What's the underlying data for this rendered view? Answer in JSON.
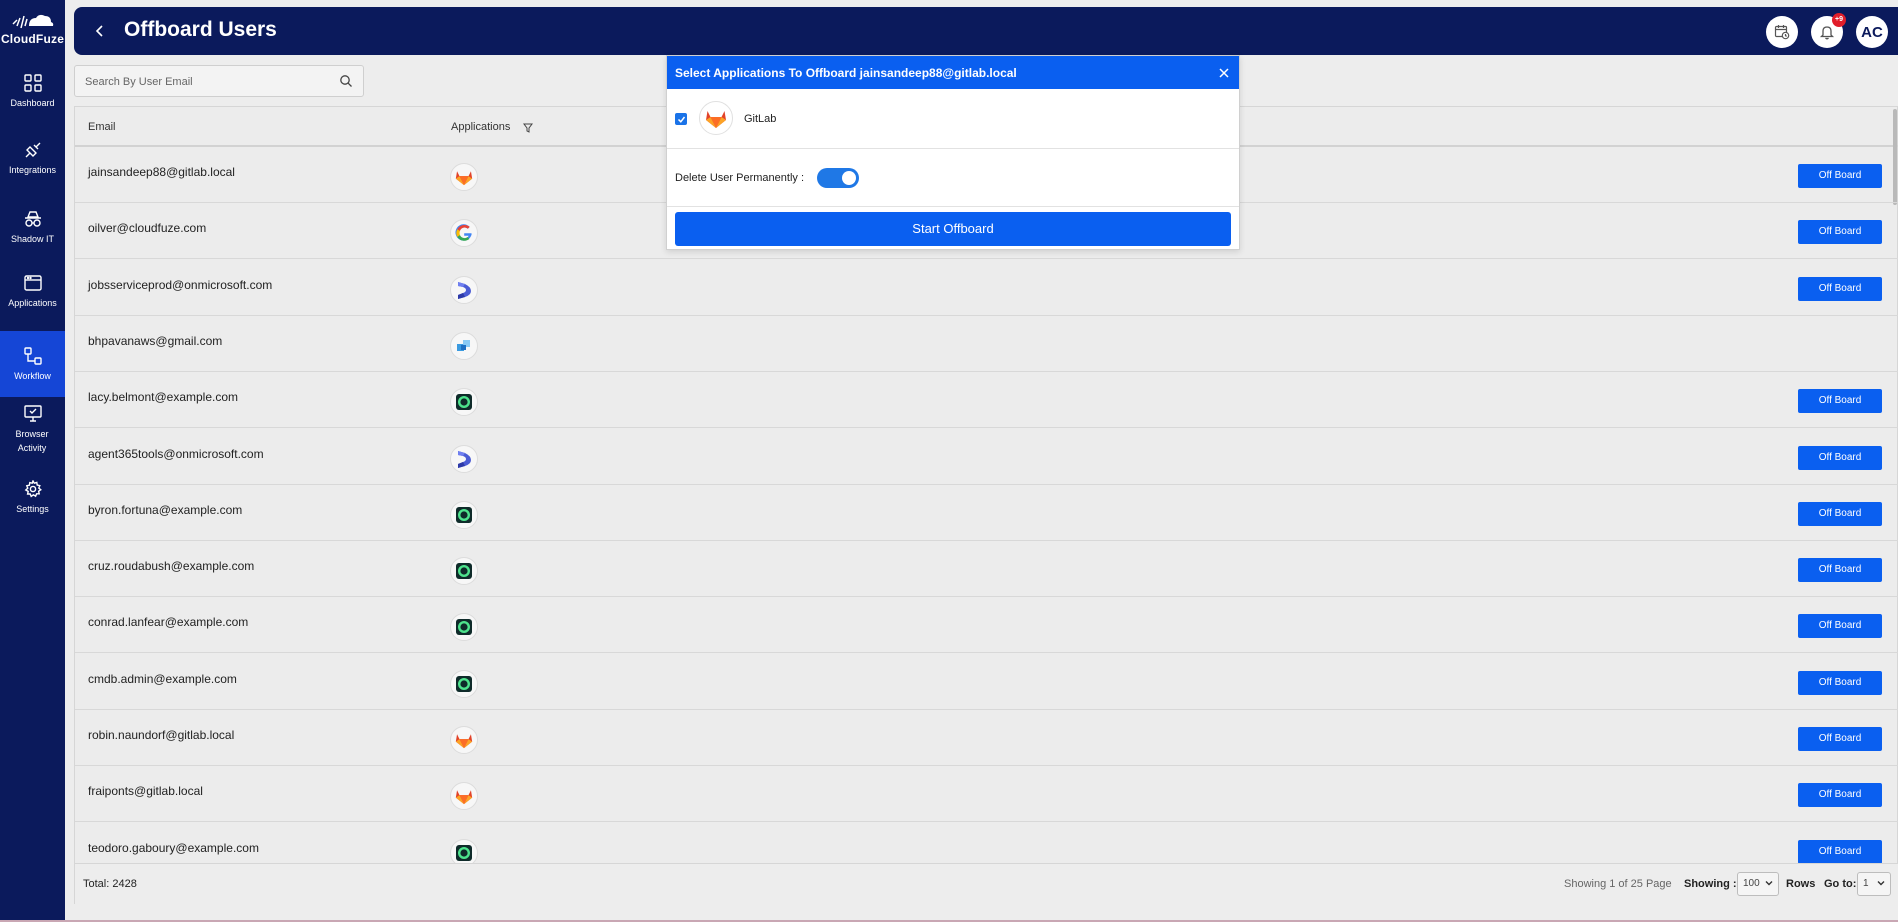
{
  "brand": {
    "name": "CloudFuze"
  },
  "sidebar": {
    "items": [
      {
        "label": "Dashboard",
        "icon": "dashboard-icon"
      },
      {
        "label": "Integrations",
        "icon": "plug-icon"
      },
      {
        "label": "Shadow IT",
        "icon": "spy-icon"
      },
      {
        "label": "Applications",
        "icon": "window-icon"
      },
      {
        "label": "Workflow",
        "icon": "workflow-icon",
        "active": true
      },
      {
        "label": "Browser Activity",
        "icon": "monitor-check-icon"
      },
      {
        "label": "Settings",
        "icon": "gear-icon"
      }
    ]
  },
  "header": {
    "title": "Offboard Users",
    "notifications_badge": "+9",
    "avatar_initials": "AC"
  },
  "search": {
    "placeholder": "Search By User Email"
  },
  "table": {
    "columns": {
      "email": "Email",
      "applications": "Applications"
    },
    "action_label": "Off Board",
    "rows": [
      {
        "email": "jainsandeep88@gitlab.local",
        "app": "gitlab",
        "action": true
      },
      {
        "email": "oilver@cloudfuze.com",
        "app": "google",
        "action": true
      },
      {
        "email": "jobsserviceprod@onmicrosoft.com",
        "app": "ms-d",
        "action": true
      },
      {
        "email": "bhpavanaws@gmail.com",
        "app": "squares",
        "action": false
      },
      {
        "email": "lacy.belmont@example.com",
        "app": "green-o",
        "action": true
      },
      {
        "email": "agent365tools@onmicrosoft.com",
        "app": "ms-d",
        "action": true
      },
      {
        "email": "byron.fortuna@example.com",
        "app": "green-o",
        "action": true
      },
      {
        "email": "cruz.roudabush@example.com",
        "app": "green-o",
        "action": true
      },
      {
        "email": "conrad.lanfear@example.com",
        "app": "green-o",
        "action": true
      },
      {
        "email": "cmdb.admin@example.com",
        "app": "green-o",
        "action": true
      },
      {
        "email": "robin.naundorf@gitlab.local",
        "app": "gitlab",
        "action": true
      },
      {
        "email": "fraiponts@gitlab.local",
        "app": "gitlab",
        "action": true
      },
      {
        "email": "teodoro.gaboury@example.com",
        "app": "green-o",
        "action": true
      }
    ]
  },
  "footer": {
    "total": "Total: 2428",
    "page_info": "Showing 1 of 25 Page",
    "showing_label": "Showing :",
    "rows_value": "100",
    "rows_label": "Rows",
    "goto_label": "Go to:",
    "goto_value": "1"
  },
  "modal": {
    "title": "Select Applications To Offboard jainsandeep88@gitlab.local",
    "app_name": "GitLab",
    "app_checked": true,
    "delete_label": "Delete User Permanently :",
    "delete_enabled": true,
    "start_label": "Start Offboard"
  },
  "colors": {
    "navy": "#0b1a5c",
    "primary": "#0a5ff0",
    "active_nav": "#1546d6"
  }
}
